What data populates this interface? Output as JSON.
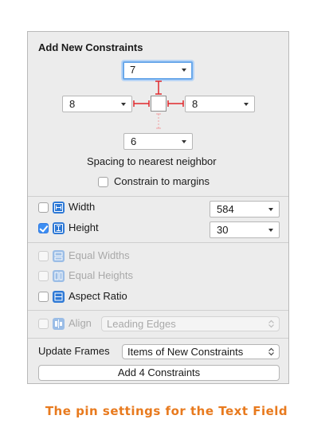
{
  "panel": {
    "title": "Add New Constraints",
    "spacing": {
      "top": "7",
      "left": "8",
      "right": "8",
      "bottom": "6"
    },
    "spacing_caption": "Spacing to nearest neighbor",
    "constrain_margins": {
      "label": "Constrain to margins",
      "checked": false
    },
    "width": {
      "label": "Width",
      "value": "584",
      "checked": false
    },
    "height": {
      "label": "Height",
      "value": "30",
      "checked": true
    },
    "equal_widths": {
      "label": "Equal Widths",
      "checked": false,
      "enabled": false
    },
    "equal_heights": {
      "label": "Equal Heights",
      "checked": false,
      "enabled": false
    },
    "aspect_ratio": {
      "label": "Aspect Ratio",
      "checked": false,
      "enabled": true
    },
    "align": {
      "label": "Align",
      "value": "Leading Edges",
      "enabled": false
    },
    "update_frames": {
      "label": "Update Frames",
      "value": "Items of New Constraints"
    },
    "add_button": "Add 4 Constraints"
  },
  "figure_caption": "The pin settings for the Text Field",
  "colors": {
    "accent": "#3d8ef3",
    "strut": "#e0282c",
    "caption": "#e87a1e"
  }
}
